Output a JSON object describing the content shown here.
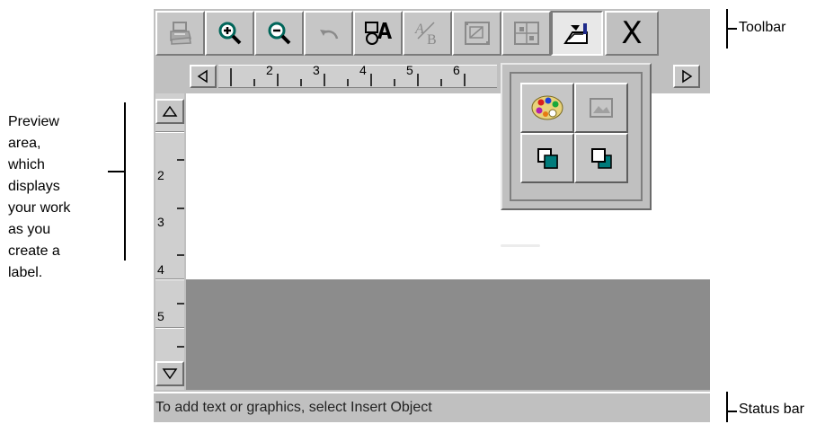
{
  "toolbar": {
    "buttons": [
      {
        "name": "print",
        "icon": "printer-icon",
        "enabled": false
      },
      {
        "name": "zoom-in",
        "icon": "zoom-in-icon",
        "enabled": true
      },
      {
        "name": "zoom-out",
        "icon": "zoom-out-icon",
        "enabled": true
      },
      {
        "name": "undo",
        "icon": "undo-icon",
        "enabled": false
      },
      {
        "name": "insert-object",
        "icon": "insert-object-icon",
        "enabled": true
      },
      {
        "name": "text-format",
        "icon": "text-format-icon",
        "enabled": false
      },
      {
        "name": "object-props",
        "icon": "object-properties-icon",
        "enabled": false
      },
      {
        "name": "align",
        "icon": "align-icon",
        "enabled": false
      },
      {
        "name": "draw-tools",
        "icon": "draw-tools-icon",
        "enabled": true,
        "pressed": true
      }
    ],
    "close_label": "X"
  },
  "hruler": {
    "numbers": [
      "2",
      "3",
      "4",
      "5",
      "6"
    ]
  },
  "vruler": {
    "numbers": [
      "2",
      "3",
      "4",
      "5"
    ]
  },
  "palette": {
    "buttons": [
      {
        "name": "color-palette",
        "icon": "color-palette-icon"
      },
      {
        "name": "picture",
        "icon": "picture-icon"
      },
      {
        "name": "send-to-back",
        "icon": "send-to-back-icon"
      },
      {
        "name": "bring-to-front",
        "icon": "bring-to-front-icon"
      }
    ]
  },
  "status": {
    "text": "To add text or graphics, select Insert Object"
  },
  "callouts": {
    "toolbar": "Toolbar",
    "status_bar": "Status bar",
    "preview": [
      "Preview",
      "area,",
      "which",
      "displays",
      "your work",
      "as you",
      "create a",
      "label."
    ]
  },
  "colors": {
    "frame": "#c0c0c0",
    "preview_bg": "#ffffff",
    "gray_area": "#8c8c8c",
    "icon_teal": "#007b7b",
    "icon_zoom": "#00806a"
  }
}
